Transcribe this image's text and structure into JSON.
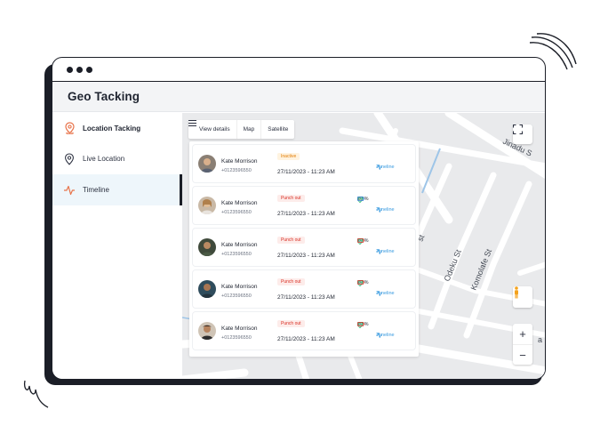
{
  "app": {
    "title": "Geo Tacking"
  },
  "sidebar": {
    "items": [
      {
        "label": "Location Tacking",
        "icon": "location-pin-icon"
      },
      {
        "label": "Live Location",
        "icon": "map-pin-icon"
      },
      {
        "label": "Timeline",
        "icon": "activity-icon"
      }
    ]
  },
  "map": {
    "tabs": [
      "View details",
      "Map",
      "Satellite"
    ],
    "streets": [
      "Jinadu S",
      "Odeku St",
      "Komolafe St",
      "st",
      "St",
      "a"
    ],
    "controls": {
      "zoom_in": "+",
      "zoom_out": "−"
    }
  },
  "timeline": {
    "timeline_label": "Timeline",
    "entries": [
      {
        "name": "Kate Morrison",
        "phone": "+0123596550",
        "status": "Inactive",
        "datetime": "27/11/2023 - 11:23 AM",
        "battery": ""
      },
      {
        "name": "Kate Morrison",
        "phone": "+0123596550",
        "status": "Punch out",
        "datetime": "27/11/2023 - 11:23 AM",
        "battery": "20 %"
      },
      {
        "name": "Kate Morrison",
        "phone": "+0123596550",
        "status": "Punch out",
        "datetime": "27/11/2023 - 11:23 AM",
        "battery": "20 %"
      },
      {
        "name": "Kate Morrison",
        "phone": "+0123596550",
        "status": "Punch out",
        "datetime": "27/11/2023 - 11:23 AM",
        "battery": "20 %"
      },
      {
        "name": "Kate Morrison",
        "phone": "+0123596550",
        "status": "Punch out",
        "datetime": "27/11/2023 - 11:23 AM",
        "battery": "20 %"
      }
    ]
  },
  "colors": {
    "accent_orange": "#e8734a",
    "link_blue": "#3a9be0",
    "status_green": "#2bb673",
    "inactive_orange": "#e27b00",
    "punch_red": "#d93025"
  }
}
